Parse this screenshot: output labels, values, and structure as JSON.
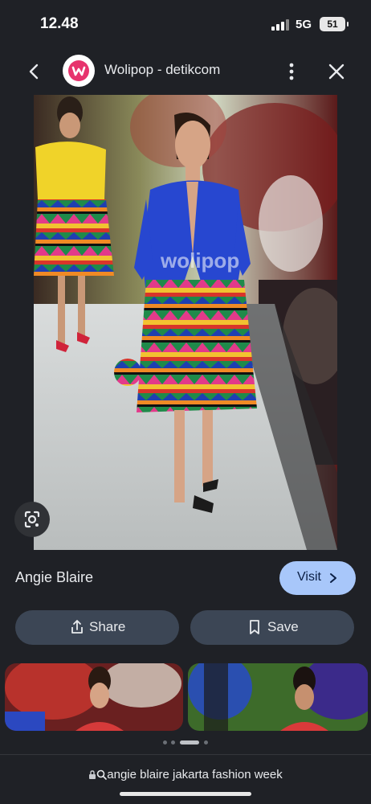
{
  "status_bar": {
    "time": "12.48",
    "network": "5G",
    "battery": "51"
  },
  "header": {
    "site_title": "Wolipop - detikcom",
    "icons": [
      "back-arrow-icon",
      "site-logo-icon",
      "more-vertical-icon",
      "close-icon"
    ]
  },
  "image": {
    "watermark": "wolipop",
    "alt_subject": "Runway model in blue shirt and colorful geometric skirt"
  },
  "result": {
    "title": "Angie Blaire",
    "visit_label": "Visit"
  },
  "actions": {
    "share_label": "Share",
    "save_label": "Save"
  },
  "carousel": {
    "page_count": 4,
    "active_index": 2
  },
  "url_bar": {
    "query": "angie blaire jakarta fashion week"
  },
  "colors": {
    "background": "#1f2126",
    "visit_button": "#a8c7fa",
    "pill_button": "#3c4655",
    "brand_logo": "#e7336d"
  }
}
